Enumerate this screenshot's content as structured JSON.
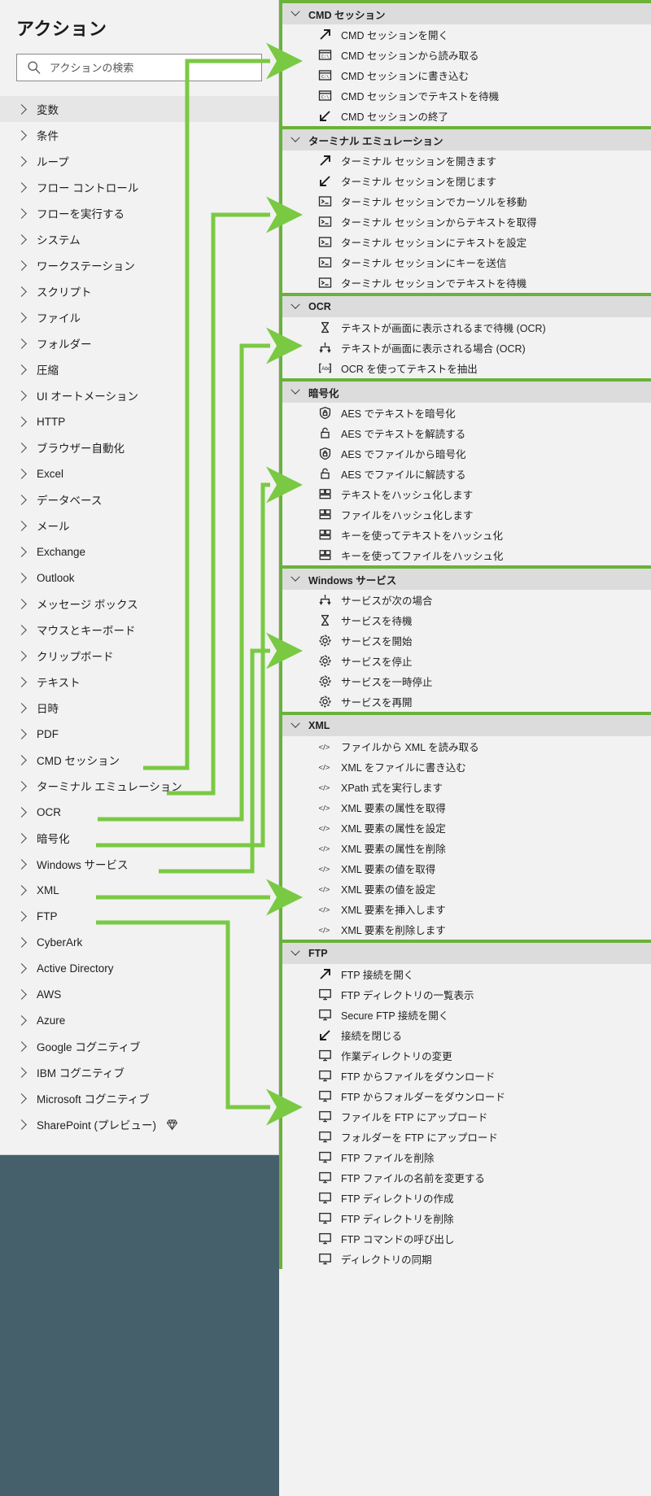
{
  "panel": {
    "title": "アクション",
    "search_placeholder": "アクションの検索",
    "search_value": ""
  },
  "sidebar": {
    "items": [
      {
        "label": "変数",
        "selected": true
      },
      {
        "label": "条件"
      },
      {
        "label": "ループ"
      },
      {
        "label": "フロー コントロール"
      },
      {
        "label": "フローを実行する"
      },
      {
        "label": "システム"
      },
      {
        "label": "ワークステーション"
      },
      {
        "label": "スクリプト"
      },
      {
        "label": "ファイル"
      },
      {
        "label": "フォルダー"
      },
      {
        "label": "圧縮"
      },
      {
        "label": "UI オートメーション"
      },
      {
        "label": "HTTP"
      },
      {
        "label": "ブラウザー自動化"
      },
      {
        "label": "Excel"
      },
      {
        "label": "データベース"
      },
      {
        "label": "メール"
      },
      {
        "label": "Exchange"
      },
      {
        "label": "Outlook"
      },
      {
        "label": "メッセージ ボックス"
      },
      {
        "label": "マウスとキーボード"
      },
      {
        "label": "クリップボード"
      },
      {
        "label": "テキスト"
      },
      {
        "label": "日時"
      },
      {
        "label": "PDF"
      },
      {
        "label": "CMD セッション"
      },
      {
        "label": "ターミナル エミュレーション"
      },
      {
        "label": "OCR"
      },
      {
        "label": "暗号化"
      },
      {
        "label": "Windows サービス"
      },
      {
        "label": "XML"
      },
      {
        "label": "FTP"
      },
      {
        "label": "CyberArk"
      },
      {
        "label": "Active Directory"
      },
      {
        "label": "AWS"
      },
      {
        "label": "Azure"
      },
      {
        "label": "Google コグニティブ"
      },
      {
        "label": "IBM コグニティブ"
      },
      {
        "label": "Microsoft コグニティブ"
      },
      {
        "label": "SharePoint (プレビュー)",
        "badge": "gem-icon"
      }
    ]
  },
  "groups": [
    {
      "title": "CMD セッション",
      "actions": [
        {
          "label": "CMD セッションを開く",
          "icon": "arrow-up-right-icon"
        },
        {
          "label": "CMD セッションから読み取る",
          "icon": "cmd-window-icon"
        },
        {
          "label": "CMD セッションに書き込む",
          "icon": "cmd-window-icon"
        },
        {
          "label": "CMD セッションでテキストを待機",
          "icon": "cmd-window-icon"
        },
        {
          "label": "CMD セッションの終了",
          "icon": "arrow-down-left-icon"
        }
      ]
    },
    {
      "title": "ターミナル エミュレーション",
      "actions": [
        {
          "label": "ターミナル セッションを開きます",
          "icon": "arrow-up-right-icon"
        },
        {
          "label": "ターミナル セッションを閉じます",
          "icon": "arrow-down-left-icon"
        },
        {
          "label": "ターミナル セッションでカーソルを移動",
          "icon": "terminal-icon"
        },
        {
          "label": "ターミナル セッションからテキストを取得",
          "icon": "terminal-icon"
        },
        {
          "label": "ターミナル セッションにテキストを設定",
          "icon": "terminal-icon"
        },
        {
          "label": "ターミナル セッションにキーを送信",
          "icon": "terminal-icon"
        },
        {
          "label": "ターミナル セッションでテキストを待機",
          "icon": "terminal-icon"
        }
      ]
    },
    {
      "title": "OCR",
      "actions": [
        {
          "label": "テキストが画面に表示されるまで待機 (OCR)",
          "icon": "hourglass-icon"
        },
        {
          "label": "テキストが画面に表示される場合 (OCR)",
          "icon": "branch-icon"
        },
        {
          "label": "OCR を使ってテキストを抽出",
          "icon": "abc-icon"
        }
      ]
    },
    {
      "title": "暗号化",
      "actions": [
        {
          "label": "AES でテキストを暗号化",
          "icon": "shield-lock-icon"
        },
        {
          "label": "AES でテキストを解読する",
          "icon": "unlock-icon"
        },
        {
          "label": "AES でファイルから暗号化",
          "icon": "shield-lock-icon"
        },
        {
          "label": "AES でファイルに解読する",
          "icon": "unlock-icon"
        },
        {
          "label": "テキストをハッシュ化します",
          "icon": "hash-icon"
        },
        {
          "label": "ファイルをハッシュ化します",
          "icon": "hash-icon"
        },
        {
          "label": "キーを使ってテキストをハッシュ化",
          "icon": "hash-icon"
        },
        {
          "label": "キーを使ってファイルをハッシュ化",
          "icon": "hash-icon"
        }
      ]
    },
    {
      "title": "Windows サービス",
      "actions": [
        {
          "label": "サービスが次の場合",
          "icon": "branch-icon"
        },
        {
          "label": "サービスを待機",
          "icon": "hourglass-icon"
        },
        {
          "label": "サービスを開始",
          "icon": "gear-icon"
        },
        {
          "label": "サービスを停止",
          "icon": "gear-icon"
        },
        {
          "label": "サービスを一時停止",
          "icon": "gear-icon"
        },
        {
          "label": "サービスを再開",
          "icon": "gear-icon"
        }
      ]
    },
    {
      "title": "XML",
      "actions": [
        {
          "label": "ファイルから XML を読み取る",
          "icon": "code-icon"
        },
        {
          "label": "XML をファイルに書き込む",
          "icon": "code-icon"
        },
        {
          "label": "XPath 式を実行します",
          "icon": "code-icon"
        },
        {
          "label": "XML 要素の属性を取得",
          "icon": "code-icon"
        },
        {
          "label": "XML 要素の属性を設定",
          "icon": "code-icon"
        },
        {
          "label": "XML 要素の属性を削除",
          "icon": "code-icon"
        },
        {
          "label": "XML 要素の値を取得",
          "icon": "code-icon"
        },
        {
          "label": "XML 要素の値を設定",
          "icon": "code-icon"
        },
        {
          "label": "XML 要素を挿入します",
          "icon": "code-icon"
        },
        {
          "label": "XML 要素を削除します",
          "icon": "code-icon"
        }
      ]
    },
    {
      "title": "FTP",
      "actions": [
        {
          "label": "FTP 接続を開く",
          "icon": "arrow-up-right-icon"
        },
        {
          "label": "FTP ディレクトリの一覧表示",
          "icon": "monitor-icon"
        },
        {
          "label": "Secure FTP 接続を開く",
          "icon": "monitor-icon"
        },
        {
          "label": "接続を閉じる",
          "icon": "arrow-down-left-icon"
        },
        {
          "label": "作業ディレクトリの変更",
          "icon": "monitor-icon"
        },
        {
          "label": "FTP からファイルをダウンロード",
          "icon": "monitor-icon"
        },
        {
          "label": "FTP からフォルダーをダウンロード",
          "icon": "monitor-icon"
        },
        {
          "label": "ファイルを FTP にアップロード",
          "icon": "monitor-icon"
        },
        {
          "label": "フォルダーを FTP にアップロード",
          "icon": "monitor-icon"
        },
        {
          "label": "FTP ファイルを削除",
          "icon": "monitor-icon"
        },
        {
          "label": "FTP ファイルの名前を変更する",
          "icon": "monitor-icon"
        },
        {
          "label": "FTP ディレクトリの作成",
          "icon": "monitor-icon"
        },
        {
          "label": "FTP ディレクトリを削除",
          "icon": "monitor-icon"
        },
        {
          "label": "FTP コマンドの呼び出し",
          "icon": "monitor-icon"
        },
        {
          "label": "ディレクトリの同期",
          "icon": "monitor-icon"
        }
      ]
    }
  ],
  "colors": {
    "accent_green": "#6ab23a",
    "panel_bg": "#f2f2f2",
    "group_header_bg": "#dcdcdc",
    "page_bg": "#46606b"
  }
}
